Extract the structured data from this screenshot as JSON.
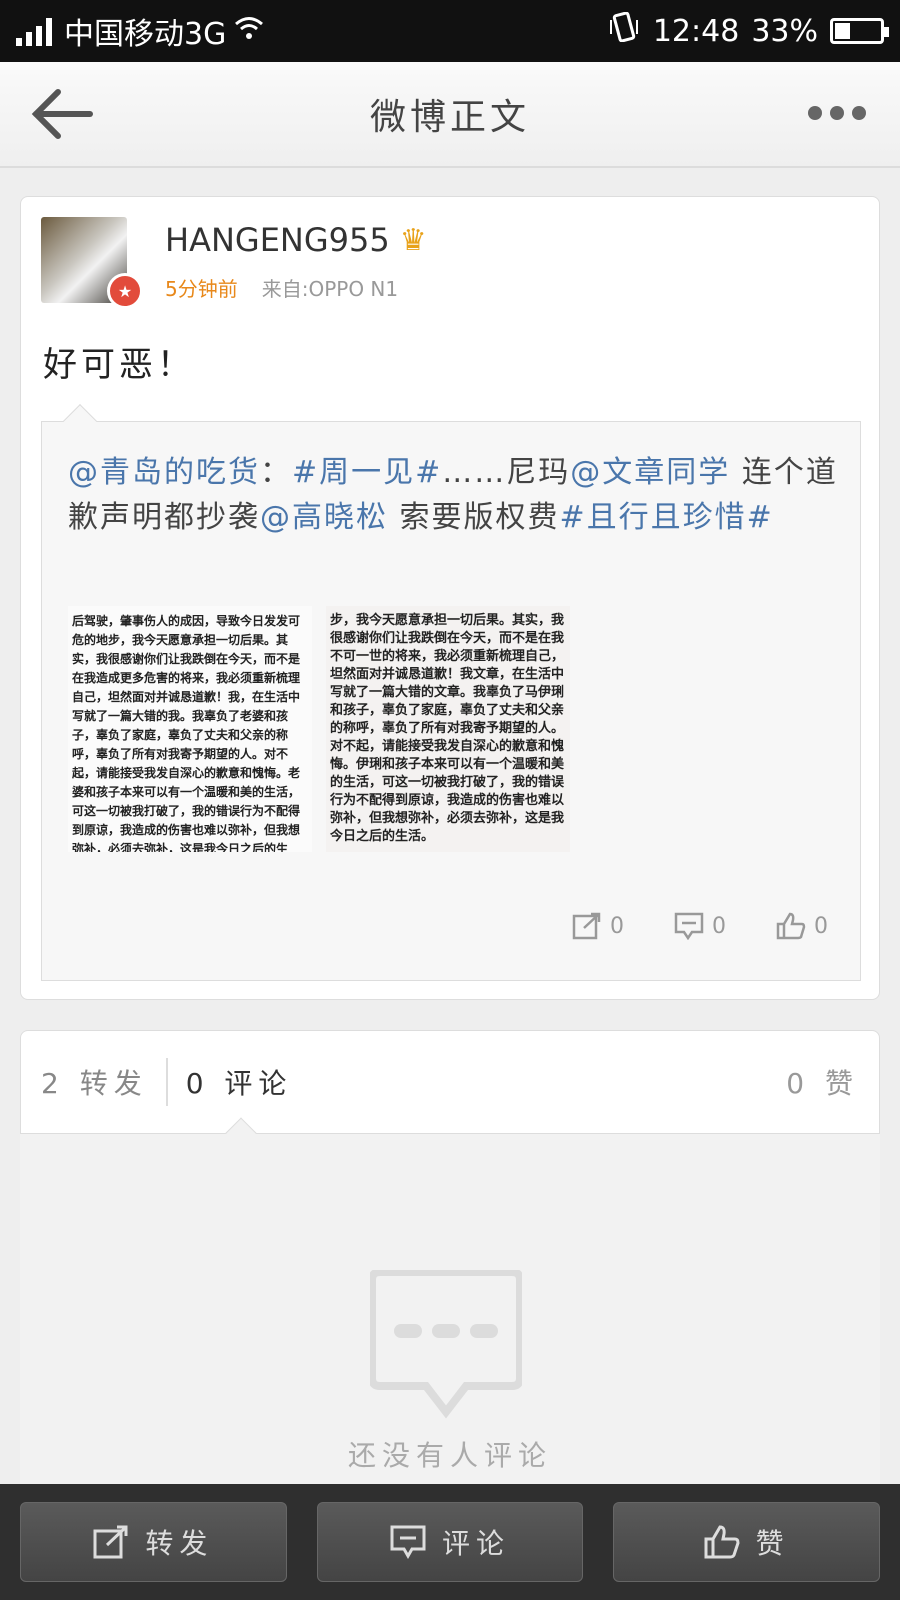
{
  "status_bar": {
    "carrier": "中国移动3G",
    "time": "12:48",
    "battery": "33%",
    "battery_level": 0.33
  },
  "header": {
    "title": "微博正文",
    "back_icon": "back-arrow-icon",
    "more_icon": "more-dots-icon"
  },
  "post": {
    "username": "HANGENG955",
    "time": "5分钟前",
    "source": "来自:OPPO N1",
    "text": "好可恶！",
    "repost": {
      "author": "@青岛的吃货",
      "sep1": "：",
      "topic1": "#周一见#",
      "plain1": "……尼玛",
      "mention1": "@文章同学",
      "plain2": " 连个道歉声明都抄袭",
      "mention2": "@高晓松",
      "plain3": "  索要版权费",
      "topic2": "#且行且珍惜#",
      "image1_text": "后驾驶，肇事伤人的成因，导致今日发发可危的地步，我今天愿意承担一切后果。其实，我很感谢你们让我跌倒在今天，而不是在我造成更多危害的将来，我必须重新梳理自己，坦然面对并诚恳道歉！我，在生活中写就了一篇大错的我。我辜负了老婆和孩子，辜负了家庭，辜负了丈夫和父亲的称呼，辜负了所有对我寄予期望的人。对不起，请能接受我发自深心的歉意和愧悔。老婆和孩子本来可以有一个温暖和美的生活，可这一切被我打破了，我的错误行为不配得到原谅，我造成的伤害也难以弥补，但我想弥补，必须去弥补，这是我今日之后的生",
      "image2_text": "步，我今天愿意承担一切后果。其实，我很感谢你们让我跌倒在今天，而不是在我不可一世的将来，我必须重新梳理自己，坦然面对并诚恳道歉！我文章，在生活中写就了一篇大错的文章。我辜负了马伊琍和孩子，辜负了家庭，辜负了丈夫和父亲的称呼，辜负了所有对我寄予期望的人。对不起，请能接受我发自深心的歉意和愧悔。伊琍和孩子本来可以有一个温暖和美的生活，可这一切被我打破了，我的错误行为不配得到原谅，我造成的伤害也难以弥补，但我想弥补，必须去弥补，这是我今日之后的生活。",
      "repost_count": "0",
      "comment_count": "0",
      "like_count": "0"
    }
  },
  "tabs": {
    "reposts": "2 转发",
    "comments": "0 评论",
    "likes": "0 赞"
  },
  "empty_state": {
    "text": "还没有人评论",
    "icon": "comment-bubble-icon"
  },
  "bottom_bar": {
    "repost": "转发",
    "comment": "评论",
    "like": "赞"
  },
  "colors": {
    "link": "#4a76ab",
    "time": "#e8881a",
    "verified_badge": "#e24b3b",
    "crown": "#e8a21a"
  }
}
